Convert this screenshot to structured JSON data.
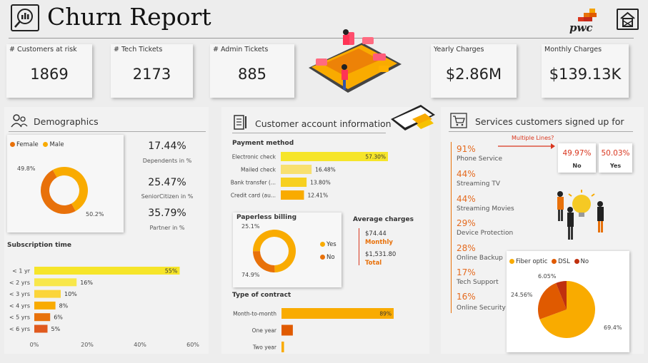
{
  "header": {
    "title": "Churn Report",
    "brand": "pwc"
  },
  "kpis": [
    {
      "label": "# Customers at risk",
      "value": "1869"
    },
    {
      "label": "# Tech Tickets",
      "value": "2173"
    },
    {
      "label": "# Admin Tickets",
      "value": "885"
    },
    {
      "label": "Yearly Charges",
      "value": "$2.86M"
    },
    {
      "label": "Monthly Charges",
      "value": "$139.13K"
    }
  ],
  "demographics": {
    "title": "Demographics",
    "stats": [
      {
        "value": "17.44%",
        "label": "Dependents in %"
      },
      {
        "value": "25.47%",
        "label": "SeniorCitizen in %"
      },
      {
        "value": "35.79%",
        "label": "Partner in %"
      }
    ],
    "subscription_title": "Subscription time"
  },
  "account": {
    "title": "Customer account information",
    "payment_title": "Payment method",
    "paperless_title": "Paperless billing",
    "avg_title": "Average charges",
    "avg_monthly_value": "$74.44",
    "avg_monthly_label": "Monthly",
    "avg_total_value": "$1,531.80",
    "avg_total_label": "Total",
    "contract_title": "Type of contract"
  },
  "services": {
    "title": "Services customers signed up for",
    "multiple_lines_label": "Multiple Lines?",
    "multiple_no_value": "49.97%",
    "multiple_no_label": "No",
    "multiple_yes_value": "50.03%",
    "multiple_yes_label": "Yes",
    "items": [
      {
        "pct": "91%",
        "name": "Phone Service"
      },
      {
        "pct": "44%",
        "name": "Streaming TV"
      },
      {
        "pct": "44%",
        "name": "Streaming Movies"
      },
      {
        "pct": "29%",
        "name": "Device Protection"
      },
      {
        "pct": "28%",
        "name": "Online Backup"
      },
      {
        "pct": "17%",
        "name": "Tech Support"
      },
      {
        "pct": "16%",
        "name": "Online Security"
      }
    ]
  },
  "colors": {
    "orange": "#e8710a",
    "dark_orange": "#e05a00",
    "amber": "#f9ab00",
    "yellow": "#f6e52a",
    "red_text": "#d9361e"
  },
  "chart_data": [
    {
      "type": "pie",
      "id": "gender",
      "categories": [
        "Female",
        "Male"
      ],
      "values": [
        49.8,
        50.2
      ],
      "labels": [
        "49.8%",
        "50.2%"
      ],
      "legend": "top-left"
    },
    {
      "type": "bar",
      "id": "subscription",
      "categories": [
        "< 1 yr",
        "< 2 yrs",
        "< 3 yrs",
        "< 4 yrs",
        "< 5 yrs",
        "< 6 yrs"
      ],
      "values": [
        55,
        16,
        10,
        8,
        6,
        5
      ],
      "labels": [
        "55%",
        "16%",
        "10%",
        "8%",
        "6%",
        "5%"
      ],
      "xticks": [
        "0%",
        "20%",
        "40%",
        "60%"
      ],
      "xlim": [
        0,
        60
      ]
    },
    {
      "type": "bar",
      "id": "payment",
      "categories": [
        "Electronic check",
        "Mailed check",
        "Bank transfer (...",
        "Credit card (au..."
      ],
      "values": [
        57.3,
        16.48,
        13.8,
        12.41
      ],
      "labels": [
        "57.30%",
        "16.48%",
        "13.80%",
        "12.41%"
      ]
    },
    {
      "type": "pie",
      "id": "paperless",
      "categories": [
        "Yes",
        "No"
      ],
      "values": [
        74.9,
        25.1
      ],
      "labels": [
        "74.9%",
        "25.1%"
      ],
      "legend": "right"
    },
    {
      "type": "bar",
      "id": "contract",
      "categories": [
        "Month-to-month",
        "One year",
        "Two year"
      ],
      "values": [
        89,
        9,
        2
      ],
      "labels": [
        "89%",
        "",
        ""
      ]
    },
    {
      "type": "pie",
      "id": "internet",
      "categories": [
        "Fiber optic",
        "DSL",
        "No"
      ],
      "values": [
        69.4,
        24.56,
        6.05
      ],
      "labels": [
        "69.4%",
        "24.56%",
        "6.05%"
      ],
      "legend": "top"
    }
  ]
}
